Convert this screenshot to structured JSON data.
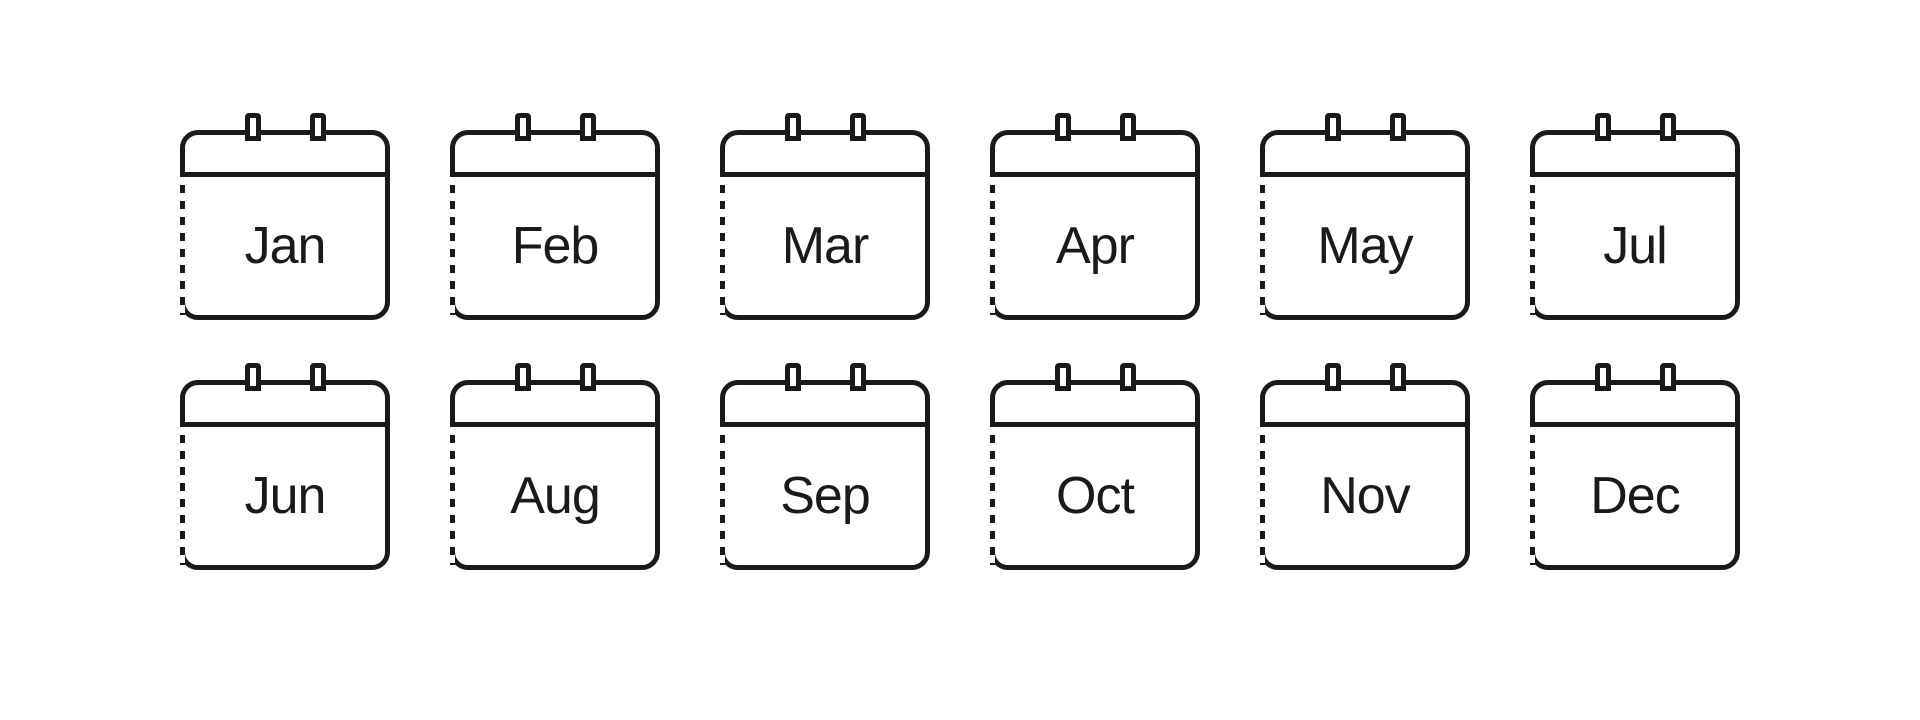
{
  "months": [
    {
      "abbr": "Jan",
      "id": "january"
    },
    {
      "abbr": "Feb",
      "id": "february"
    },
    {
      "abbr": "Mar",
      "id": "march"
    },
    {
      "abbr": "Apr",
      "id": "april"
    },
    {
      "abbr": "May",
      "id": "may"
    },
    {
      "abbr": "Jul",
      "id": "july"
    },
    {
      "abbr": "Jun",
      "id": "june"
    },
    {
      "abbr": "Aug",
      "id": "august"
    },
    {
      "abbr": "Sep",
      "id": "september"
    },
    {
      "abbr": "Oct",
      "id": "october"
    },
    {
      "abbr": "Nov",
      "id": "november"
    },
    {
      "abbr": "Dec",
      "id": "december"
    }
  ]
}
